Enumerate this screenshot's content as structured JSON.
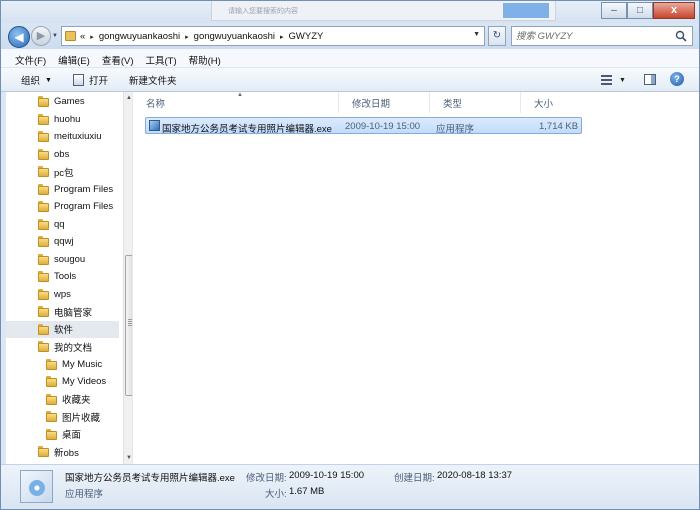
{
  "window": {
    "ghost_text": "请输入您要搜索的内容",
    "controls": {
      "minimize": "–",
      "maximize": "□",
      "close": "x"
    }
  },
  "address": {
    "prefix": "«",
    "crumbs": [
      "gongwuyuankaoshi",
      "gongwuyuankaoshi",
      "GWYZY"
    ],
    "separator": "▸"
  },
  "search": {
    "placeholder": "搜索 GWYZY"
  },
  "menu": [
    "文件(F)",
    "编辑(E)",
    "查看(V)",
    "工具(T)",
    "帮助(H)"
  ],
  "toolbar": {
    "organize": "组织",
    "open": "打开",
    "new_folder": "新建文件夹"
  },
  "nav": {
    "items": [
      {
        "label": "Games",
        "selected": false
      },
      {
        "label": "huohu",
        "selected": false
      },
      {
        "label": "meituxiuxiu",
        "selected": false
      },
      {
        "label": "obs",
        "selected": false
      },
      {
        "label": "pc包",
        "selected": false
      },
      {
        "label": "Program Files",
        "selected": false
      },
      {
        "label": "Program Files",
        "selected": false
      },
      {
        "label": "qq",
        "selected": false
      },
      {
        "label": "qqwj",
        "selected": false
      },
      {
        "label": "sougou",
        "selected": false
      },
      {
        "label": "Tools",
        "selected": false
      },
      {
        "label": "wps",
        "selected": false
      },
      {
        "label": "电脑管家",
        "selected": false
      },
      {
        "label": "软件",
        "selected": true
      },
      {
        "label": "我的文档",
        "selected": false
      },
      {
        "label": "My Music",
        "selected": false
      },
      {
        "label": "My Videos",
        "selected": false
      },
      {
        "label": "收藏夹",
        "selected": false
      },
      {
        "label": "图片收藏",
        "selected": false
      },
      {
        "label": "桌面",
        "selected": false
      },
      {
        "label": "新obs",
        "selected": false
      }
    ]
  },
  "columns": {
    "name": "名称",
    "modified": "修改日期",
    "type": "类型",
    "size": "大小"
  },
  "files": [
    {
      "name": "国家地方公务员考试专用照片编辑器.exe",
      "modified": "2009-10-19 15:00",
      "type": "应用程序",
      "size": "1,714 KB",
      "selected": true
    }
  ],
  "details": {
    "filename": "国家地方公务员考试专用照片编辑器.exe",
    "type": "应用程序",
    "modified_label": "修改日期:",
    "modified": "2009-10-19 15:00",
    "created_label": "创建日期:",
    "created": "2020-08-18 13:37",
    "size_label": "大小:",
    "size": "1.67 MB"
  },
  "colors": {
    "selection": "#cce8ff",
    "chrome": "#dce7f3",
    "accent": "#2a69b8"
  }
}
